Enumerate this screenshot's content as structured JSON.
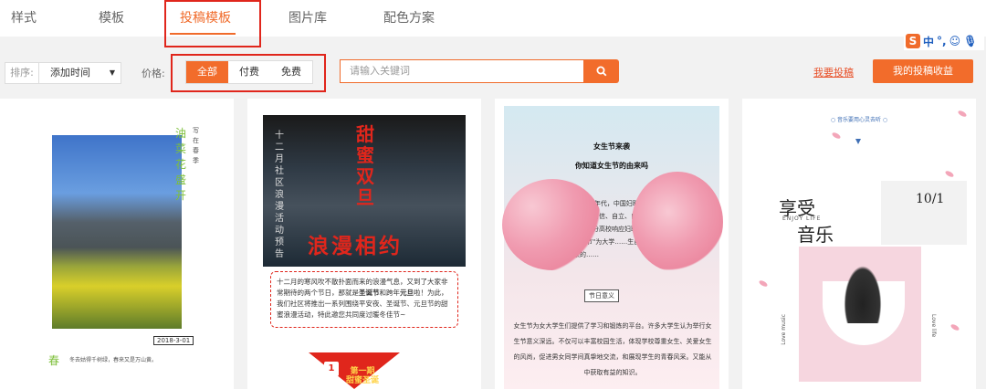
{
  "tabs": [
    {
      "label": "样式"
    },
    {
      "label": "模板"
    },
    {
      "label": "投稿模板",
      "active": true
    },
    {
      "label": "图片库"
    },
    {
      "label": "配色方案"
    }
  ],
  "ime": {
    "logo": "S",
    "mode": "中"
  },
  "filter": {
    "sort_label": "排序:",
    "sort_value": "添加时间",
    "price_label": "价格:",
    "price_options": [
      "全部",
      "付费",
      "免费"
    ],
    "price_selected": "全部",
    "search_placeholder": "请输入关键词",
    "contribute_link": "我要投稿",
    "income_button": "我的投稿收益"
  },
  "cards": [
    {
      "vertical_title": "油菜花盛开",
      "vertical_small": "写在春季",
      "date": "2018-3-01",
      "season": "春",
      "note": "冬去姑得千树绿，春来又是万山黄。"
    },
    {
      "vertical_text": "十二月社区浪漫活动预告",
      "title_vertical": "甜蜜双旦",
      "title_big": "浪漫相约",
      "desc_parts": [
        "十二月的寒风吹不散扑面而来的浪漫气息，又到了大家非常期待的两个节日，那就是",
        "圣诞节",
        "和跨年",
        "元旦",
        "啦！为此，我们社区将推出一系列围绕平安夜、圣诞节、元旦节的甜蜜浪漫活动，特此邀您共同度过暖冬佳节~"
      ],
      "badge_num": "1",
      "badge_text_1": "第一期",
      "badge_text_2": "甜蜜圣诞"
    },
    {
      "title": "女生节来袭",
      "subtitle": "你知道女生节的由来吗",
      "text": "世纪90年代，中国妇联号召自尊、自信、自立、自强……分高校响应妇联……女生节\"为大学……生自身形象的……",
      "tag": "节日意义",
      "body": "女生节为女大学生们提供了学习和锻炼的平台。许多大学生认为举行女生节意义深远。不仅可以丰富校园生活，体现学校尊重女生、关爱女生的风尚，促进男女同学间真挚地交流，和展现学生的青春风采。又能从中获取有益的知识。"
    },
    {
      "top_line": "○ 音乐要用心灵去听 ○",
      "title_1": "享受",
      "enjoy": "ENJOY LIFE",
      "title_2": "音乐",
      "date": "10/1",
      "love_music": "Love music",
      "love_life": "Love life"
    }
  ],
  "colors": {
    "accent": "#f26c2b",
    "highlight_box": "#e0261c",
    "text_active": "#f06b2b"
  }
}
